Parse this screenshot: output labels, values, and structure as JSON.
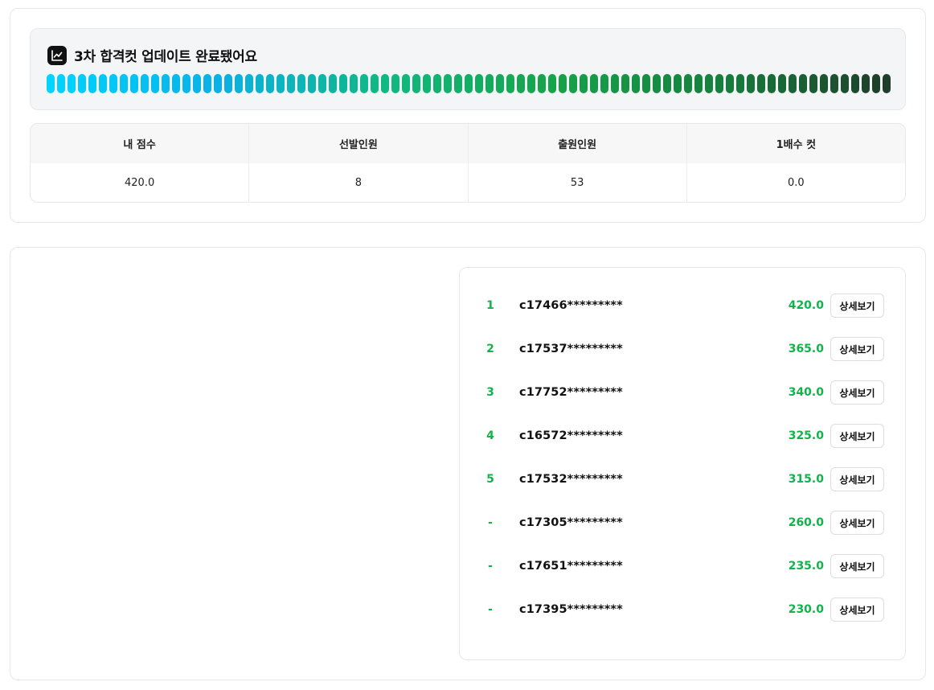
{
  "banner": {
    "title": "3차 합격컷 업데이트 완료됐어요",
    "icon": "line-chart-icon",
    "pill_count": 81,
    "gradient_colors": [
      "#00d4ff",
      "#0ab0e6",
      "#10b981",
      "#16a34a",
      "#15803d",
      "#1f3d2a"
    ]
  },
  "stats": {
    "headers": [
      "내 점수",
      "선발인원",
      "출원인원",
      "1배수 컷"
    ],
    "values": [
      "420.0",
      "8",
      "53",
      "0.0"
    ]
  },
  "ranking": {
    "detail_label": "상세보기",
    "accent_color": "#12b34a",
    "rows": [
      {
        "rank": "1",
        "id": "c17466*********",
        "score": "420.0"
      },
      {
        "rank": "2",
        "id": "c17537*********",
        "score": "365.0"
      },
      {
        "rank": "3",
        "id": "c17752*********",
        "score": "340.0"
      },
      {
        "rank": "4",
        "id": "c16572*********",
        "score": "325.0"
      },
      {
        "rank": "5",
        "id": "c17532*********",
        "score": "315.0"
      },
      {
        "rank": "-",
        "id": "c17305*********",
        "score": "260.0"
      },
      {
        "rank": "-",
        "id": "c17651*********",
        "score": "235.0"
      },
      {
        "rank": "-",
        "id": "c17395*********",
        "score": "230.0"
      }
    ]
  }
}
